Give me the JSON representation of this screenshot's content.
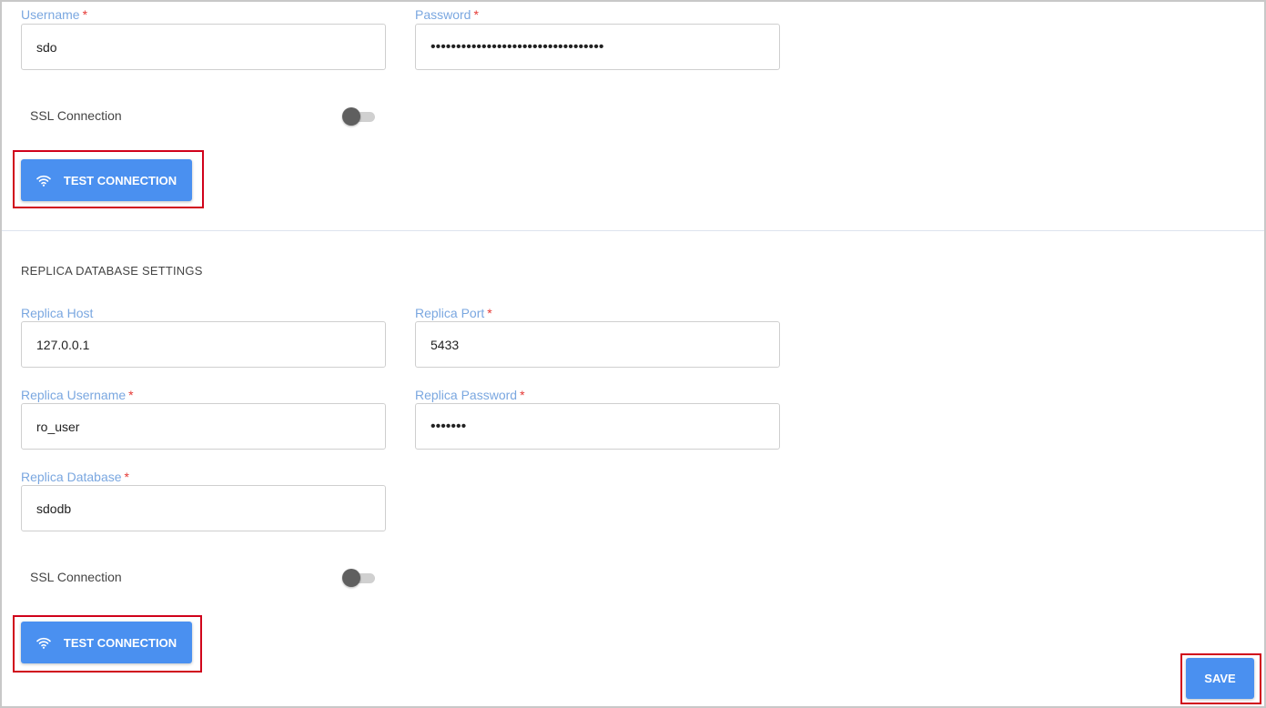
{
  "primary": {
    "username": {
      "label": "Username",
      "required": "*",
      "value": "sdo"
    },
    "password": {
      "label": "Password",
      "required": "*",
      "value": "••••••••••••••••••••••••••••••••••"
    },
    "ssl": {
      "label": "SSL Connection",
      "enabled": false
    },
    "test_button": {
      "label": "TEST CONNECTION",
      "icon": "wifi-icon"
    }
  },
  "replica": {
    "section_title": "REPLICA DATABASE SETTINGS",
    "host": {
      "label": "Replica Host",
      "value": "127.0.0.1"
    },
    "port": {
      "label": "Replica Port",
      "required": "*",
      "value": "5433"
    },
    "username": {
      "label": "Replica Username",
      "required": "*",
      "value": "ro_user"
    },
    "password": {
      "label": "Replica Password",
      "required": "*",
      "value": "•••••••"
    },
    "database": {
      "label": "Replica Database",
      "required": "*",
      "value": "sdodb"
    },
    "ssl": {
      "label": "SSL Connection",
      "enabled": false
    },
    "test_button": {
      "label": "TEST CONNECTION",
      "icon": "wifi-icon"
    }
  },
  "save_button": {
    "label": "SAVE"
  },
  "colors": {
    "accent": "#4a90f0",
    "label": "#7aa7e0",
    "required": "#e53935",
    "highlight": "#d0021b"
  }
}
